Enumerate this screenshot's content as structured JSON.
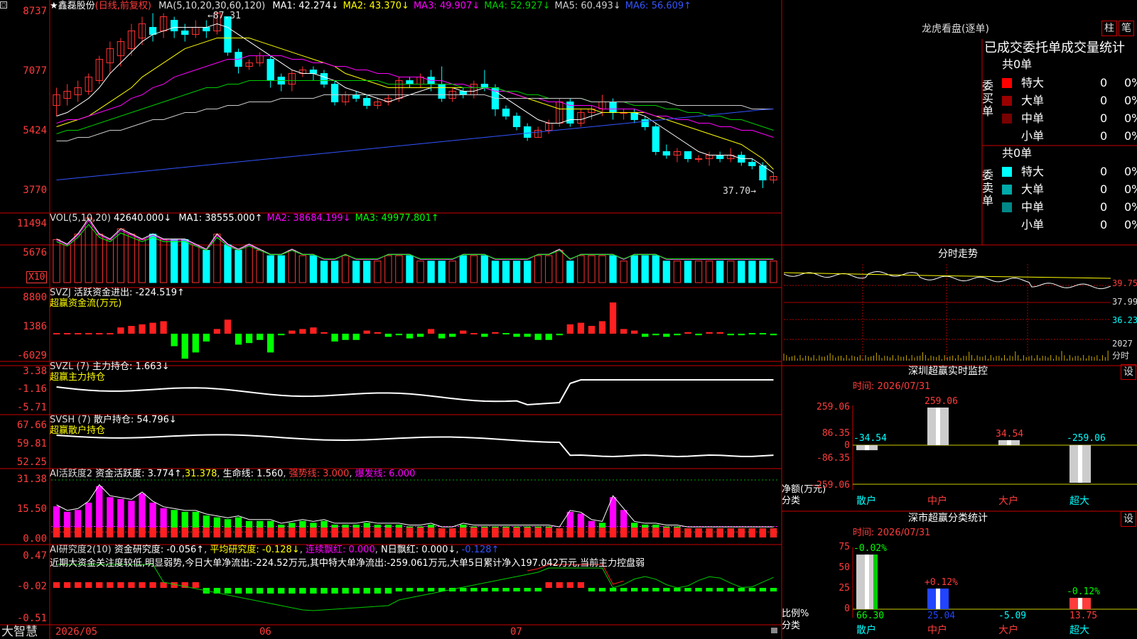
{
  "app": {
    "brand": "大智慧"
  },
  "kline": {
    "stock_label": "★鑫磊股份",
    "mode_label": "(日线,前复权)",
    "ma_label": "MA(5,10,20,30,60,120)",
    "ma": [
      {
        "text": "MA1: 42.274↓",
        "color": "#ffffff"
      },
      {
        "text": "MA2: 43.370↓",
        "color": "#ffff00"
      },
      {
        "text": "MA3: 49.907↓",
        "color": "#ff00ff"
      },
      {
        "text": "MA4: 52.927↓",
        "color": "#00cc00"
      },
      {
        "text": "MA5: 60.493↓",
        "color": "#cccccc"
      },
      {
        "text": "MA6: 56.609↑",
        "color": "#3355ff"
      }
    ],
    "yaxis": [
      "8737",
      "7077",
      "5424",
      "3770"
    ],
    "high_label": "87.31",
    "low_label": "37.70",
    "candles": [
      [
        61,
        64,
        58,
        66
      ],
      [
        63,
        65,
        61,
        67
      ],
      [
        64,
        66,
        62,
        68
      ],
      [
        65,
        69,
        64,
        70
      ],
      [
        68,
        74,
        67,
        75
      ],
      [
        73,
        77,
        70,
        79
      ],
      [
        75,
        79,
        72,
        80
      ],
      [
        77,
        82,
        75,
        84
      ],
      [
        80,
        84,
        78,
        86
      ],
      [
        83,
        81,
        79,
        87
      ],
      [
        82,
        86,
        80,
        87
      ],
      [
        85,
        82,
        80,
        86
      ],
      [
        82,
        81,
        79,
        84
      ],
      [
        81,
        83,
        80,
        85
      ],
      [
        83,
        82,
        80,
        85
      ],
      [
        82,
        87,
        81,
        87.31
      ],
      [
        86,
        76,
        75,
        86
      ],
      [
        76,
        72,
        70,
        77
      ],
      [
        72,
        73,
        71,
        74
      ],
      [
        73,
        75,
        72,
        76
      ],
      [
        74,
        68,
        66,
        75
      ],
      [
        69,
        67,
        65,
        70
      ],
      [
        67,
        70,
        65,
        71
      ],
      [
        70,
        71,
        69,
        72
      ],
      [
        71,
        70,
        68,
        72
      ],
      [
        70,
        67,
        66,
        71
      ],
      [
        67,
        62,
        61,
        68
      ],
      [
        62,
        64,
        61,
        65
      ],
      [
        64,
        63,
        62,
        65
      ],
      [
        63,
        61,
        60,
        64
      ],
      [
        61,
        62,
        60,
        63
      ],
      [
        62,
        63,
        61,
        64
      ],
      [
        63,
        68,
        62,
        69
      ],
      [
        68,
        67,
        66,
        69
      ],
      [
        67,
        69,
        66,
        70
      ],
      [
        69,
        67,
        65,
        71
      ],
      [
        67,
        63,
        62,
        72
      ],
      [
        63,
        65,
        62,
        66
      ],
      [
        65,
        64,
        63,
        66
      ],
      [
        64,
        67,
        63,
        68
      ],
      [
        67,
        66,
        65,
        71
      ],
      [
        66,
        60,
        58,
        67
      ],
      [
        60,
        58,
        57,
        61
      ],
      [
        58,
        55,
        54,
        59
      ],
      [
        55,
        52,
        51,
        56
      ],
      [
        52,
        54,
        52,
        55
      ],
      [
        54,
        56,
        53,
        57
      ],
      [
        56,
        62,
        55,
        63
      ],
      [
        62,
        56,
        55,
        63
      ],
      [
        56,
        59,
        55,
        60
      ],
      [
        59,
        60,
        57,
        61
      ],
      [
        60,
        62,
        58,
        64
      ],
      [
        62,
        59,
        57,
        63
      ],
      [
        59,
        59,
        57,
        60
      ],
      [
        59,
        57,
        56,
        60
      ],
      [
        57,
        55,
        54,
        58
      ],
      [
        55,
        48,
        47,
        56
      ],
      [
        48,
        47,
        46,
        50
      ],
      [
        47,
        48,
        45,
        49
      ],
      [
        48,
        46,
        45,
        48
      ],
      [
        46,
        46,
        45,
        47
      ],
      [
        46,
        47,
        44,
        48
      ],
      [
        47,
        46,
        45,
        48
      ],
      [
        46,
        47,
        45,
        49
      ],
      [
        47,
        45,
        44,
        48
      ],
      [
        45,
        44,
        43,
        46
      ],
      [
        44,
        40,
        37.7,
        45
      ],
      [
        40,
        41,
        39,
        42
      ]
    ],
    "ma_lines": [
      {
        "color": "#ffffff",
        "values": [
          58,
          59,
          61,
          63,
          66,
          70,
          73,
          76,
          79,
          81,
          82,
          83,
          83,
          83,
          83,
          84,
          83,
          81,
          79,
          77,
          75,
          73,
          71,
          70,
          70,
          69,
          68,
          66,
          65,
          64,
          63,
          62,
          63,
          64,
          65,
          66,
          66,
          66,
          65,
          65,
          66,
          65,
          63,
          61,
          59,
          57,
          56,
          56,
          57,
          57,
          58,
          59,
          59,
          59,
          59,
          58,
          56,
          54,
          52,
          50,
          48,
          47,
          47,
          47,
          46,
          46,
          44,
          42
        ]
      },
      {
        "color": "#ffff00",
        "values": [
          55,
          56,
          57,
          58,
          60,
          62,
          64,
          66,
          69,
          71,
          73,
          75,
          77,
          78,
          79,
          80,
          80,
          80,
          80,
          79,
          78,
          77,
          76,
          75,
          74,
          73,
          72,
          70,
          69,
          68,
          67,
          66,
          66,
          66,
          66,
          66,
          66,
          66,
          66,
          66,
          66,
          66,
          65,
          64,
          63,
          62,
          61,
          60,
          60,
          60,
          60,
          59,
          59,
          59,
          59,
          59,
          58,
          57,
          56,
          55,
          54,
          53,
          52,
          51,
          50,
          48,
          46,
          43
        ]
      },
      {
        "color": "#ff00ff",
        "values": [
          56,
          57,
          57,
          58,
          59,
          60,
          61,
          63,
          64,
          66,
          67,
          69,
          70,
          71,
          72,
          73,
          74,
          74,
          75,
          75,
          75,
          75,
          74,
          74,
          73,
          73,
          72,
          72,
          71,
          71,
          70,
          70,
          69,
          69,
          69,
          68,
          68,
          67,
          67,
          66,
          66,
          65,
          65,
          64,
          63,
          63,
          62,
          62,
          61,
          61,
          61,
          60,
          60,
          60,
          60,
          59,
          58,
          58,
          57,
          57,
          56,
          56,
          55,
          55,
          54,
          54,
          53,
          52
        ]
      },
      {
        "color": "#00cc00",
        "values": [
          53,
          54,
          54,
          55,
          56,
          57,
          58,
          59,
          60,
          61,
          62,
          63,
          64,
          65,
          66,
          66,
          67,
          67,
          68,
          68,
          68,
          68,
          68,
          68,
          68,
          68,
          68,
          68,
          68,
          68,
          68,
          67,
          67,
          67,
          67,
          67,
          67,
          67,
          66,
          66,
          66,
          66,
          65,
          65,
          64,
          64,
          63,
          63,
          63,
          63,
          62,
          62,
          62,
          62,
          61,
          61,
          61,
          60,
          60,
          59,
          59,
          58,
          58,
          57,
          57,
          56,
          55,
          54
        ]
      },
      {
        "color": "#cccccc",
        "values": [
          51,
          51,
          52,
          52,
          53,
          54,
          54,
          55,
          56,
          57,
          57,
          58,
          59,
          59,
          60,
          60,
          61,
          61,
          62,
          62,
          62,
          63,
          63,
          63,
          63,
          64,
          64,
          64,
          64,
          64,
          64,
          64,
          64,
          64,
          64,
          64,
          64,
          64,
          64,
          64,
          64,
          63,
          63,
          63,
          63,
          63,
          63,
          63,
          63,
          63,
          62,
          62,
          62,
          62,
          62,
          62,
          62,
          62,
          61,
          61,
          61,
          61,
          61,
          61,
          61,
          60,
          60,
          60
        ]
      },
      {
        "color": "#3355ff",
        "values": [
          40,
          40.3,
          40.6,
          40.9,
          41.2,
          41.5,
          41.8,
          42.1,
          42.4,
          42.7,
          43,
          43.3,
          43.6,
          43.9,
          44.2,
          44.5,
          44.8,
          45.1,
          45.4,
          45.7,
          46,
          46.3,
          46.6,
          46.9,
          47.2,
          47.5,
          47.8,
          48.1,
          48.4,
          48.7,
          49,
          49.3,
          49.6,
          49.9,
          50.2,
          50.5,
          50.8,
          51.1,
          51.4,
          51.7,
          52,
          52.3,
          52.6,
          52.9,
          53.2,
          53.5,
          53.8,
          54.1,
          54.4,
          54.7,
          55,
          55.3,
          55.6,
          55.9,
          56.2,
          56.5,
          56.8,
          57.1,
          57.4,
          57.7,
          58,
          58.3,
          58.6,
          58.9,
          59.2,
          59.5,
          59.8,
          60
        ]
      }
    ]
  },
  "vol": {
    "title": "VOL(5,10,20)",
    "val": "42640.000↓",
    "ma": [
      {
        "text": "MA1: 38555.000↑",
        "color": "#ffffff"
      },
      {
        "text": "MA2: 38684.199↓",
        "color": "#ff00ff"
      },
      {
        "text": "MA3: 49977.801↑",
        "color": "#00ff00"
      }
    ],
    "yaxis": [
      "11494",
      "5676"
    ],
    "unit": "X10",
    "values": [
      8,
      7,
      9,
      12,
      9,
      8,
      10,
      9,
      8,
      9,
      8,
      8,
      8,
      7,
      6,
      9,
      7,
      6,
      7,
      6,
      5,
      5,
      6,
      5,
      5,
      4,
      4,
      5,
      4,
      4,
      4,
      5,
      5,
      5,
      4,
      4,
      4,
      4,
      5,
      5,
      5,
      4,
      4,
      4,
      4,
      5,
      5,
      6,
      4,
      5,
      5,
      5,
      5,
      4,
      5,
      5,
      5,
      4,
      4,
      4,
      4,
      4,
      4,
      4,
      4,
      4,
      4,
      4
    ]
  },
  "svzj": {
    "title": "SVZJ",
    "desc": "活跃资金进出: -224.519↑",
    "sub": "超赢资金流(万元)",
    "yaxis": [
      "8800",
      "1386",
      "-6029"
    ],
    "values": [
      0,
      0,
      0,
      0,
      0,
      0,
      0.4,
      0.5,
      0.6,
      0.7,
      0.8,
      -0.8,
      -1.6,
      -1.2,
      -0.5,
      0.3,
      0.9,
      -0.7,
      -0.6,
      -0.4,
      -1.2,
      -0.1,
      0.2,
      0.3,
      0.4,
      0.1,
      -0.5,
      -0.4,
      -0.4,
      0.2,
      0.1,
      -0.2,
      -0.1,
      -0.3,
      -0.2,
      0.3,
      -0.3,
      -0.2,
      0.2,
      0,
      -0.2,
      0.1,
      0,
      -0.2,
      -0.2,
      -0.4,
      -0.4,
      -0.1,
      0.6,
      0.7,
      0.5,
      0.8,
      2.0,
      0.3,
      0.2,
      -0.2,
      -0.1,
      -0.2,
      -0.1,
      0.1,
      -0.1,
      0.1,
      0.1,
      -0.1,
      -0.1,
      0,
      0,
      -0.1
    ]
  },
  "svzl": {
    "title": "SVZL (7)",
    "desc": "主力持仓: 1.663↓",
    "sub": "超赢主力持仓",
    "yaxis": [
      "3.38",
      "-1.16",
      "-5.71"
    ]
  },
  "svsh": {
    "title": "SVSH (7)",
    "desc": "散户持仓: 54.796↓",
    "sub": "超赢散户持仓",
    "yaxis": [
      "67.66",
      "59.81",
      "52.25"
    ]
  },
  "ai1": {
    "title": "AI活跃度2",
    "desc": "资金活跃度: 3.774↑",
    "v2": "31.378",
    "v3": "生命线: 1.560",
    "v4": "强势线: 3.000",
    "v5": "爆发线: 6.000",
    "yaxis": [
      "31.38",
      "15.50",
      "0.00"
    ],
    "values": [
      17,
      14,
      15,
      19,
      28,
      22,
      21,
      20,
      24,
      19,
      16,
      15,
      14,
      14,
      12,
      11,
      10,
      11,
      9,
      9,
      9,
      7,
      8,
      9,
      8,
      9,
      7,
      7,
      7,
      8,
      7,
      7,
      7,
      6,
      6,
      7,
      5,
      5,
      7,
      6,
      6,
      6,
      6,
      6,
      6,
      6,
      6,
      5,
      14,
      13,
      9,
      8,
      22,
      15,
      8,
      7,
      7,
      6,
      6,
      5,
      5,
      5,
      5,
      5,
      5,
      5,
      5,
      5
    ]
  },
  "ai2": {
    "title": "AI研究度2(10)",
    "desc": "资金研究度: -0.056↑",
    "v2": "平均研究度: -0.128↓",
    "v3": "连续飘红: 0.000",
    "v4": "N日飘红: 0.000↓",
    "v5": "-0.128↑",
    "yaxis": [
      "0.47",
      "-0.02",
      "-0.51"
    ],
    "comment": "近期大资金关注度较低,明显弱势,今日大单净流出:-224.52万元,其中特大单净流出:-259.061万元,大单5日累计净入197.042万元,当前主力控盘弱"
  },
  "xaxis": [
    "2026/05",
    "06",
    "07"
  ],
  "dragon": {
    "title": "龙虎看盘(逐单)",
    "btn1": "柱",
    "btn2": "笔",
    "tabs": "已成交委托单成交量统计",
    "total_buy": "共0单",
    "total_sell": "共0单",
    "buy_label": "委买单",
    "sell_label": "委卖单",
    "buy": [
      {
        "name": "特大",
        "n": "0",
        "p": "0%",
        "color": "#ff0000"
      },
      {
        "name": "大单",
        "n": "0",
        "p": "0%",
        "color": "#990000"
      },
      {
        "name": "中单",
        "n": "0",
        "p": "0%",
        "color": "#770000"
      },
      {
        "name": "小单",
        "n": "0",
        "p": "0%",
        "color": ""
      }
    ],
    "sell": [
      {
        "name": "特大",
        "n": "0",
        "p": "0%",
        "color": "#00ffff"
      },
      {
        "name": "大单",
        "n": "0",
        "p": "0%",
        "color": "#00aaaa"
      },
      {
        "name": "中单",
        "n": "0",
        "p": "0%",
        "color": "#008888"
      },
      {
        "name": "小单",
        "n": "0",
        "p": "0%",
        "color": ""
      }
    ]
  },
  "intraday": {
    "title": "分时走势",
    "y": [
      "39.75",
      "37.99",
      "36.23",
      "2027"
    ],
    "unit": "分时"
  },
  "sz1": {
    "title": "深圳超赢实时监控",
    "btn": "设",
    "time": "时间: 2026/07/31",
    "yaxis": [
      "259.06",
      "86.35",
      "0",
      "-86.35",
      "-259.06"
    ],
    "ylabel": "净额(万元)",
    "xlabel": "分类",
    "bars": [
      {
        "cat": "散户",
        "value": -34.54,
        "label": "-34.54"
      },
      {
        "cat": "中户",
        "value": 259.06,
        "label": "259.06"
      },
      {
        "cat": "大户",
        "value": 34.54,
        "label": "34.54"
      },
      {
        "cat": "超大",
        "value": -259.06,
        "label": "-259.06"
      }
    ]
  },
  "sz2": {
    "title": "深市超赢分类统计",
    "btn": "设",
    "time": "时间: 2026/07/31",
    "yaxis": [
      "75",
      "50",
      "25",
      "0"
    ],
    "ylabel": "比例%",
    "xlabel": "分类",
    "bars": [
      {
        "cat": "散户",
        "value": 66.3,
        "label": "66.30",
        "top": "-0.02%"
      },
      {
        "cat": "中户",
        "value": 25.04,
        "label": "25.04",
        "top": "+0.12%"
      },
      {
        "cat": "大户",
        "value": -5.09,
        "label": "-5.09",
        "top": ""
      },
      {
        "cat": "超大",
        "value": 13.75,
        "label": "13.75",
        "top": "-0.12%"
      }
    ]
  }
}
